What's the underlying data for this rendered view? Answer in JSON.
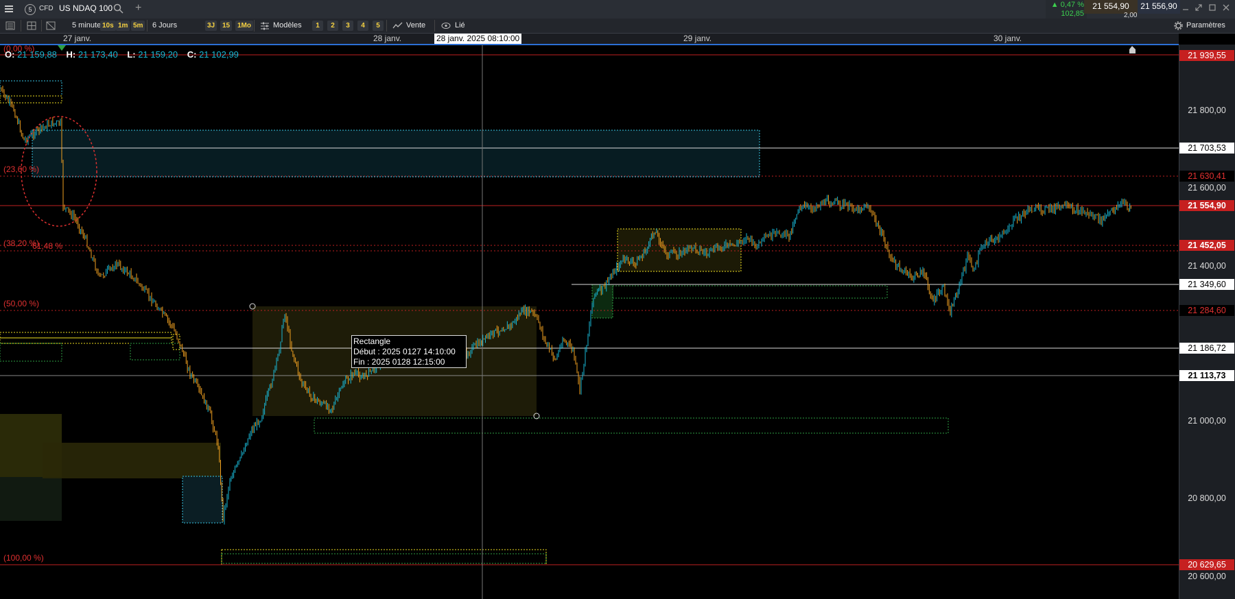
{
  "topbar": {
    "instrument_badge": "5",
    "instrument_type": "CFD",
    "instrument_name": "US NDAQ 100",
    "change_pct": "▲ 0,47 %",
    "change_pts": "102,85",
    "bid": "21 554,90",
    "ask": "21 556,90",
    "spread": "2,00"
  },
  "toolbar": {
    "interval": "5 minutes",
    "quick_intervals": [
      "10s",
      "1m",
      "5m"
    ],
    "range": "6 Jours",
    "quick_ranges": [
      "3J",
      "15",
      "1Mo"
    ],
    "models_label": "Modèles",
    "model_slots": [
      "1",
      "2",
      "3",
      "4",
      "5"
    ],
    "mode_label": "Vente",
    "linked_label": "Lié",
    "settings_label": "Paramètres"
  },
  "time_axis": {
    "labels": [
      "27 janv.",
      "28 janv.",
      "29 janv.",
      "30 janv."
    ],
    "crosshair_time": "28 janv. 2025 08:10:00"
  },
  "ohlc": {
    "o_label": "O:",
    "o_value": "21 159,88",
    "h_label": "H:",
    "h_value": "21 173,40",
    "l_label": "L:",
    "l_value": "21 159,20",
    "c_label": "C:",
    "c_value": "21 102,99"
  },
  "fib_labels": [
    "(0,00 %)",
    "(23,60 %)",
    "(38,20 %)",
    "61,48 %",
    "(50,00 %)",
    "(100,00 %)"
  ],
  "price_axis": {
    "ticks": [
      "21 800,00",
      "21 600,00",
      "21 400,00",
      "21 000,00",
      "20 800,00",
      "20 600,00"
    ],
    "markers": {
      "top": "21 939,55",
      "white1": "21 703,53",
      "red1": "21 630,41",
      "last": "21 554,90",
      "fib382": "21 452,05",
      "white2": "21 349,60",
      "red2": "21 284,60",
      "white3": "21 186,72",
      "crosshair": "21 113,73",
      "bottom": "20 629,65"
    }
  },
  "tooltip": {
    "title": "Rectangle",
    "start": "Début : 2025 0127 14:10:00",
    "end": "Fin : 2025 0128 12:15:00"
  },
  "chart_data": {
    "type": "candlestick",
    "instrument": "US NDAQ 100",
    "interval": "5 minutes",
    "x_labels": [
      "27 janv.",
      "28 janv.",
      "29 janv.",
      "30 janv."
    ],
    "ylim": [
      20560,
      21950
    ],
    "series": [
      {
        "name": "US NDAQ 100",
        "x": [
          "27 janv.",
          "28 janv.",
          "29 janv.",
          "30 janv."
        ],
        "close": [
          21780,
          21110,
          21480,
          21555
        ]
      }
    ]
  },
  "colors": {
    "bull": "#19b8d6",
    "bear": "#f0a020",
    "fib": "#e03030",
    "zone_yellow": "#f0e020",
    "zone_cyan": "#38c8e8",
    "zone_green": "#2ea043"
  }
}
